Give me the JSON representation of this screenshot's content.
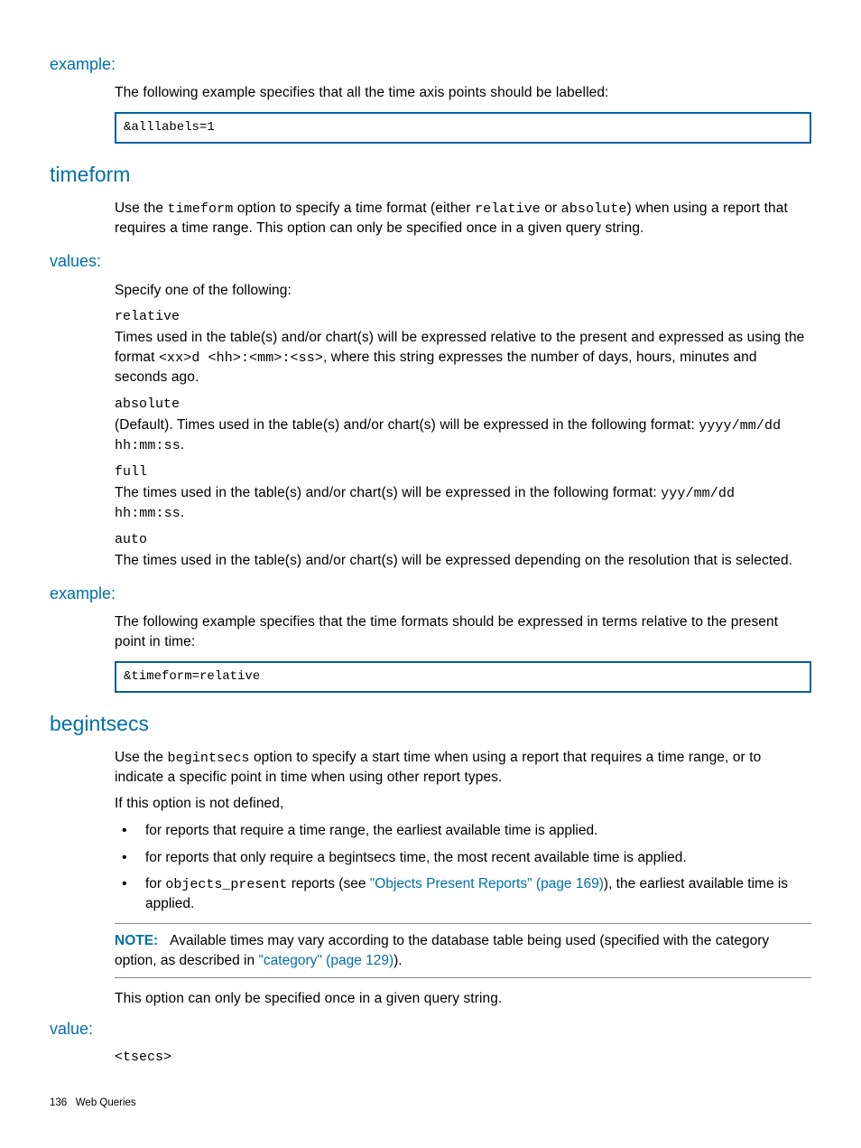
{
  "sec_example1": {
    "heading": "example:",
    "para": "The following example specifies that all the time axis points should be labelled:",
    "code": "&alllabels=1"
  },
  "sec_timeform": {
    "heading": "timeform",
    "intro_pre": "Use the ",
    "intro_code1": "timeform",
    "intro_mid": " option to specify a time format (either ",
    "intro_code2": "relative",
    "intro_or": " or ",
    "intro_code3": "absolute",
    "intro_post": ") when using a report that requires a time range. This option can only be specified once in a given query string."
  },
  "sec_values": {
    "heading": "values:",
    "intro": "Specify one of the following:",
    "relative_term": "relative",
    "relative_desc_pre": "Times used in the table(s) and/or chart(s) will be expressed relative to the present and expressed as using the format ",
    "relative_desc_code": "<xx>d <hh>:<mm>:<ss>",
    "relative_desc_post": ", where this string expresses the number of days, hours, minutes and seconds ago.",
    "absolute_term": "absolute",
    "absolute_desc_pre": "(Default). Times used in the table(s) and/or chart(s) will be expressed in the following format: ",
    "absolute_desc_code": "yyyy/mm/dd hh:mm:ss",
    "absolute_desc_post": ".",
    "full_term": "full",
    "full_desc_pre": "The times used in the table(s) and/or chart(s) will be expressed in the following format: ",
    "full_desc_code": "yyy/mm/dd hh:mm:ss",
    "full_desc_post": ".",
    "auto_term": "auto",
    "auto_desc": "The times used in the table(s) and/or chart(s) will be expressed depending on the resolution that is selected."
  },
  "sec_example2": {
    "heading": "example:",
    "para": "The following example specifies that the time formats should be expressed in terms relative to the present point in time:",
    "code": "&timeform=relative"
  },
  "sec_begintsecs": {
    "heading": "begintsecs",
    "p1_pre": "Use the ",
    "p1_code": "begintsecs",
    "p1_post": " option to specify a start time when using a report that requires a time range, or to indicate a specific point in time when using other report types.",
    "p2": "If this option is not defined,",
    "b1": "for reports that require a time range, the earliest available time is applied.",
    "b2": "for reports that only require a begintsecs time, the most recent available time is applied.",
    "b3_pre": "for ",
    "b3_code": "objects_present",
    "b3_mid": " reports (see ",
    "b3_link": "\"Objects Present Reports\" (page 169)",
    "b3_post": "), the earliest available time is applied.",
    "note_label": "NOTE:",
    "note_pre": "Available times may vary according to the database table being used (specified with the category option, as described in ",
    "note_link": "\"category\" (page 129)",
    "note_post": ").",
    "p3": "This option can only be specified once in a given query string."
  },
  "sec_value": {
    "heading": "value:",
    "term": "<tsecs>"
  },
  "footer": {
    "page": "136",
    "title": "Web Queries"
  }
}
